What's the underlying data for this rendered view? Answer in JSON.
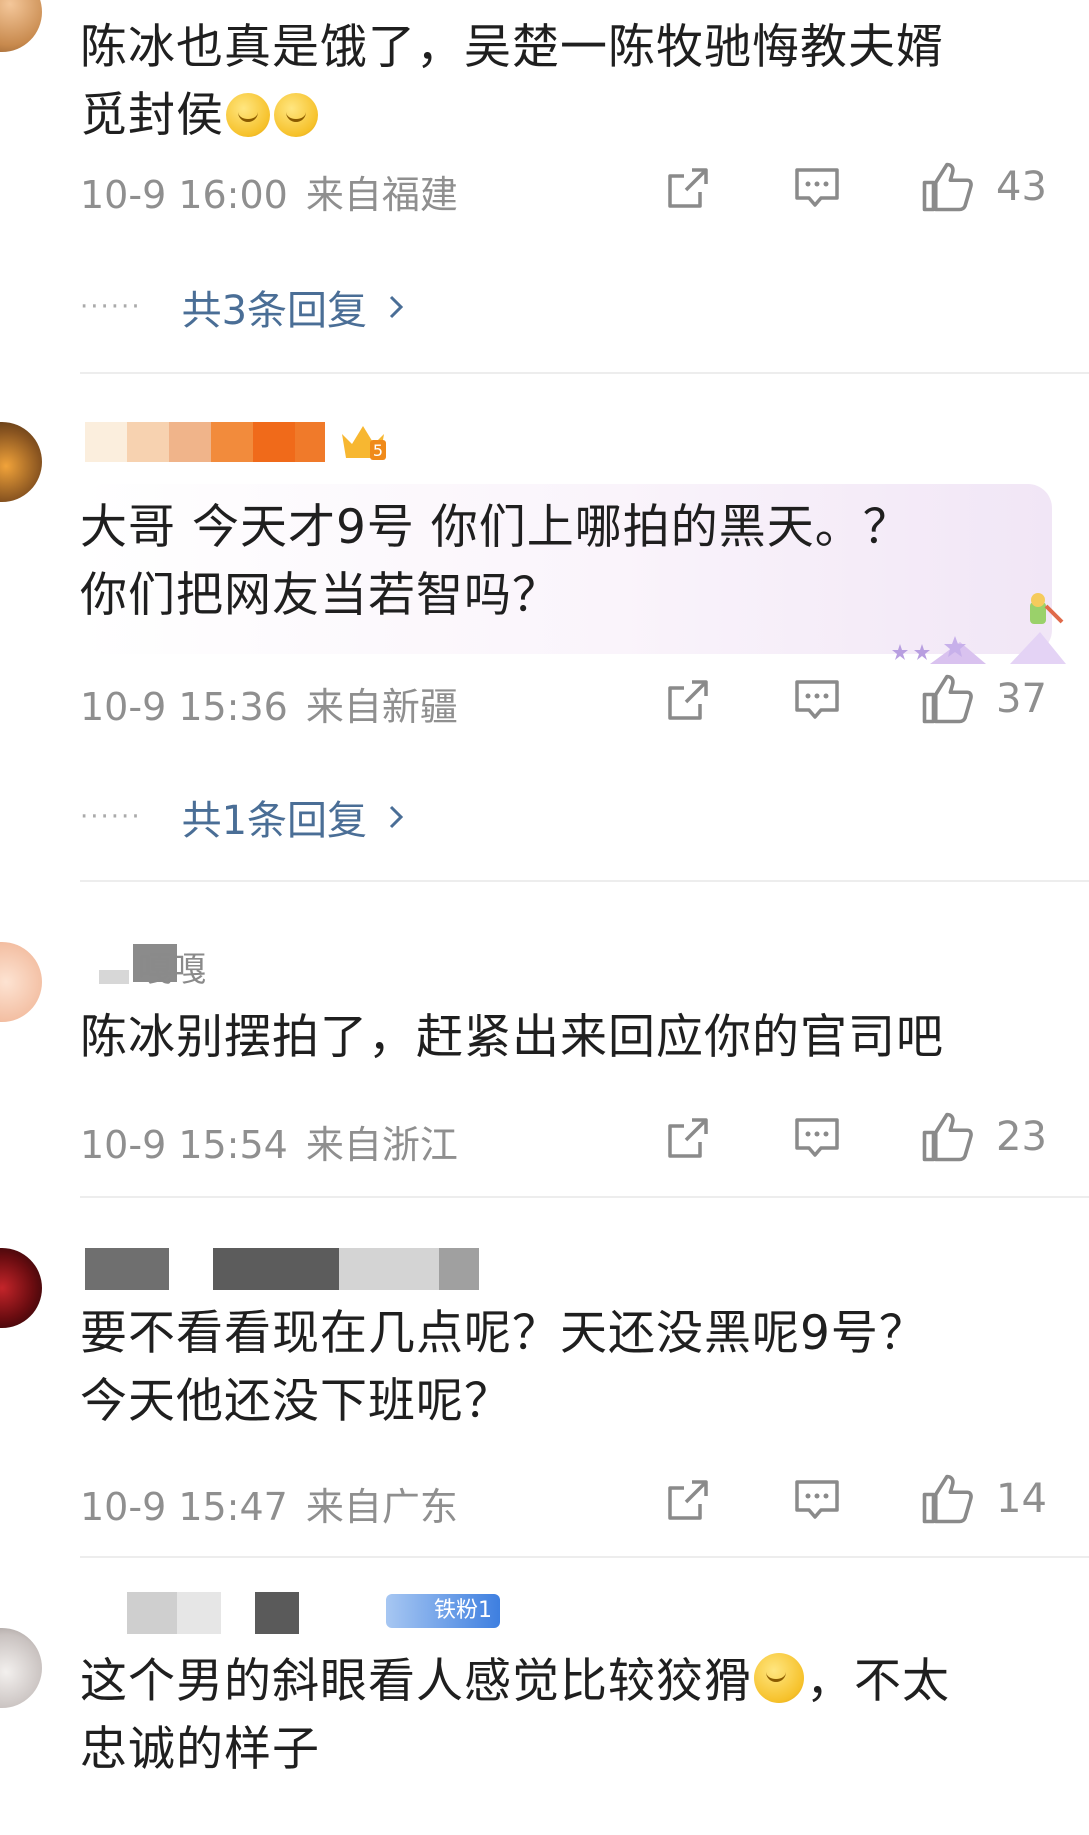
{
  "comments": [
    {
      "text_a": "陈冰也真是饿了，吴楚一陈牧驰悔教夫婿",
      "text_b": "觅封侯",
      "date": "10-9 16:00",
      "location": "来自福建",
      "likes": "43",
      "replies": "共3条回复"
    },
    {
      "text_a": "大哥 今天才9号 你们上哪拍的黑天。？",
      "text_b": "你们把网友当若智吗？",
      "date": "10-9 15:36",
      "location": "来自新疆",
      "likes": "37",
      "replies": "共1条回复"
    },
    {
      "username_partial": "嘎嘎",
      "text_a": "陈冰别摆拍了，赶紧出来回应你的官司吧",
      "date": "10-9 15:54",
      "location": "来自浙江",
      "likes": "23"
    },
    {
      "text_a": "要不看看现在几点呢？天还没黑呢9号？",
      "text_b": "今天他还没下班呢？",
      "date": "10-9 15:47",
      "location": "来自广东",
      "likes": "14"
    },
    {
      "fan_badge": "铁粉1",
      "text_a": "这个男的斜眼看人感觉比较狡猾",
      "text_a2": "，不太",
      "text_b": "忠诚的样子"
    }
  ],
  "icons": {
    "share": "share-icon",
    "comment": "comment-icon",
    "like": "thumbs-up-icon",
    "more": "chevron-right-icon"
  },
  "colors": {
    "reply_link": "#4a6e96",
    "meta_gray": "#8f8f8f",
    "divider": "#ededed"
  }
}
